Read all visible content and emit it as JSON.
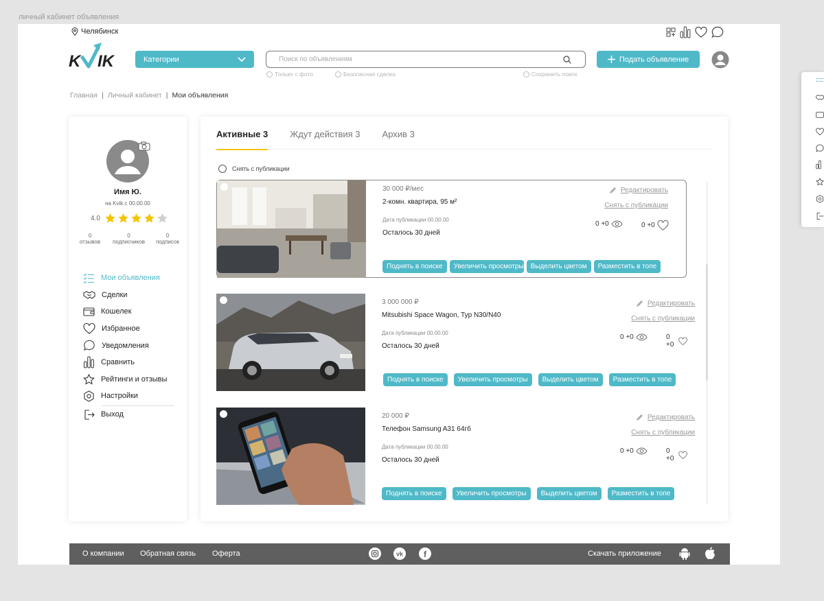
{
  "frame_label": "личный кабинет объявления",
  "header": {
    "city": "Челябинск",
    "logo_text": "KVIK",
    "categories_label": "Категории",
    "search_placeholder": "Поиск по объявлениям",
    "search_options": [
      "Только с фото",
      "Безопасная сделка",
      "Сохранить поиск"
    ],
    "post_button": "Подать объявление",
    "icons": [
      "grid-plus-icon",
      "compare-icon",
      "heart-icon",
      "chat-icon"
    ]
  },
  "breadcrumbs": [
    "Главная",
    "Личный кабинет",
    "Мои объявления"
  ],
  "profile": {
    "name": "Имя Ю.",
    "since": "на Kvik с 00.00.00",
    "rating": "4.0",
    "stars_filled": 4,
    "stars_total": 5,
    "stats": [
      {
        "value": "0",
        "label": "отзывов"
      },
      {
        "value": "0",
        "label": "подписчиков"
      },
      {
        "value": "0",
        "label": "подписок"
      }
    ]
  },
  "menu": [
    {
      "label": "Мои объявления",
      "icon": "checklist-icon"
    },
    {
      "label": "Сделки",
      "icon": "handshake-icon"
    },
    {
      "label": "Кошелек",
      "icon": "wallet-icon"
    },
    {
      "label": "Избранное",
      "icon": "heart-icon"
    },
    {
      "label": "Уведомления",
      "icon": "chat-icon"
    },
    {
      "label": "Сравнить",
      "icon": "compare-icon"
    },
    {
      "label": "Рейтинги и отзывы",
      "icon": "star-icon"
    },
    {
      "label": "Настройки",
      "icon": "settings-icon"
    },
    {
      "label": "Выход",
      "icon": "logout-icon"
    }
  ],
  "tabs": [
    "Активные 3",
    "Ждут действия 3",
    "Архив 3"
  ],
  "unpublish_all": "Снять с публикации",
  "listings": [
    {
      "price": "30 000 ₽/мес",
      "title": "2-комн. квартира, 95 м²",
      "date": "Дата публикации 00.00.00",
      "left": "Осталось 30 дней",
      "views": "0 +0",
      "likes": "0 +0",
      "edit": "Редактировать",
      "unpublish": "Снять с публикации",
      "actions": [
        "Поднять в поиске",
        "Увеличить просмотры",
        "Выделить цветом",
        "Разместить в топе"
      ]
    },
    {
      "price": "3 000 000 ₽",
      "title": "Mitsubishi Space Wagon, Typ N30/N40",
      "date": "Дата публикации 00.00.00",
      "left": "Осталось 30 дней",
      "views": "0 +0",
      "likes": "0 +0",
      "edit": "Редактировать",
      "unpublish": "Снять с публикации",
      "actions": [
        "Поднять в поиске",
        "Увеличить просмотры",
        "Выделить цветом",
        "Разместить в топе"
      ]
    },
    {
      "price": "20 000 ₽",
      "title": "Телефон Samsung A31 64гб",
      "date": "Дата публикации 00.00.00",
      "left": "Осталось 30 дней",
      "views": "0 +0",
      "likes": "0 +0",
      "edit": "Редактировать",
      "unpublish": "Снять с  публикации",
      "actions": [
        "Поднять в поиске",
        "Увеличить просмотры",
        "Выделить цветом",
        "Разместить в топе"
      ]
    }
  ],
  "footer": {
    "links": [
      "О компании",
      "Обратная связь",
      "Оферта"
    ],
    "download": "Скачать приложение"
  },
  "colors": {
    "accent": "#4fb9c8",
    "tab_underline": "#f3c400",
    "footer_bg": "#5f5f5f"
  }
}
